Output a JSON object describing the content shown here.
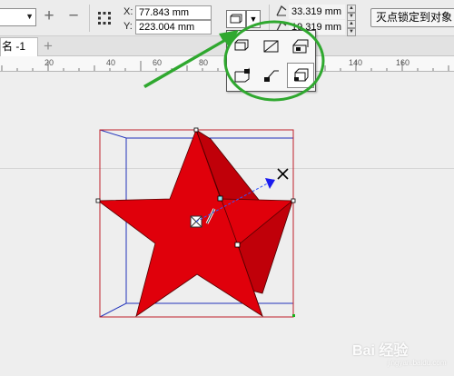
{
  "property_bar": {
    "add_label": "+",
    "remove_label": "−",
    "x_label": "X:",
    "x_value": "77.843 mm",
    "y_label": "Y:",
    "y_value": "223.004 mm",
    "depth_value_1": "33.319 mm",
    "depth_value_2": "19.319 mm",
    "lock_vanishing_point_label": "灭点锁定到对象"
  },
  "tabs": {
    "document_tab_label": "名 -1",
    "add_tab_label": "+"
  },
  "ruler": {
    "ticks": [
      "20",
      "40",
      "60",
      "80",
      "140",
      "160"
    ]
  },
  "vanishing_point_menu": {
    "options": [
      "vp-option-1",
      "vp-option-2",
      "vp-option-3",
      "vp-option-4",
      "vp-option-5",
      "vp-option-6"
    ],
    "selected_index": 5
  },
  "canvas": {
    "object": "extruded-star",
    "fill_color": "#e0000b",
    "shade_color": "#c00009"
  },
  "annotation_colors": {
    "arrow": "#2fa82f",
    "ellipse": "#2fa82f"
  },
  "watermark": {
    "logo_text": "Bai 经验",
    "sub_text": "jingyan.baidu.com"
  }
}
